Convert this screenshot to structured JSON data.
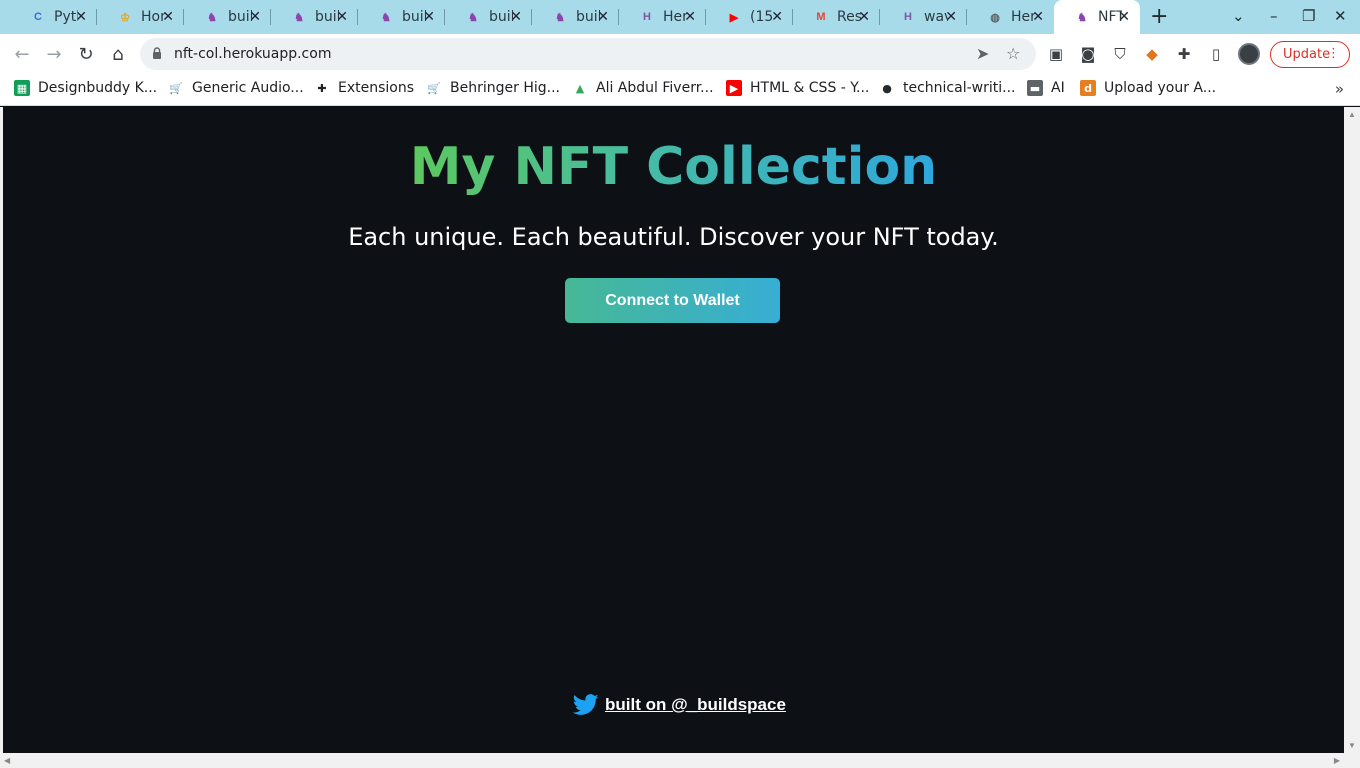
{
  "browser": {
    "tabs": [
      {
        "label": "Pyth",
        "icon": "c-logo-icon",
        "color": "#3b6fd8"
      },
      {
        "label": "Hon",
        "icon": "trophy-icon",
        "color": "#e8a317"
      },
      {
        "label": "buil",
        "icon": "unicorn-icon",
        "color": "#8e44ad"
      },
      {
        "label": "buil",
        "icon": "unicorn-icon",
        "color": "#8e44ad"
      },
      {
        "label": "buil",
        "icon": "unicorn-icon",
        "color": "#8e44ad"
      },
      {
        "label": "buil",
        "icon": "unicorn-icon",
        "color": "#8e44ad"
      },
      {
        "label": "buil",
        "icon": "unicorn-icon",
        "color": "#8e44ad"
      },
      {
        "label": "Her",
        "icon": "heroku-icon",
        "color": "#79589f"
      },
      {
        "label": "(15",
        "icon": "youtube-icon",
        "color": "#ff0000"
      },
      {
        "label": "Res",
        "icon": "gmail-icon",
        "color": "#ea4335"
      },
      {
        "label": "wav",
        "icon": "heroku-icon",
        "color": "#79589f"
      },
      {
        "label": "Her",
        "icon": "globe-icon",
        "color": "#5f6368"
      },
      {
        "label": "NFT",
        "icon": "unicorn-icon",
        "color": "#8e44ad",
        "active": true
      }
    ],
    "url": "nft-col.herokuapp.com",
    "update_label": "Update",
    "bookmarks": [
      {
        "label": "Designbuddy K...",
        "icon": "sheets-icon",
        "color": "#0f9d58"
      },
      {
        "label": "Generic Audio...",
        "icon": "cart-icon",
        "color": "#d35400"
      },
      {
        "label": "Extensions",
        "icon": "puzzle-icon",
        "color": "#202124"
      },
      {
        "label": "Behringer Hig...",
        "icon": "cart-icon",
        "color": "#d35400"
      },
      {
        "label": "Ali Abdul Fiverr...",
        "icon": "drive-icon",
        "color": "#34a853"
      },
      {
        "label": "HTML & CSS - Y...",
        "icon": "youtube-icon",
        "color": "#ff0000"
      },
      {
        "label": "technical-writi...",
        "icon": "github-icon",
        "color": "#24292e"
      },
      {
        "label": "AI",
        "icon": "folder-icon",
        "color": "#5f6368"
      },
      {
        "label": "Upload your A...",
        "icon": "d-logo-icon",
        "color": "#e67e22"
      }
    ]
  },
  "page": {
    "title": "My NFT Collection",
    "subtitle": "Each unique. Each beautiful. Discover your NFT today.",
    "cta_label": "Connect to Wallet",
    "footer_link": "built on @_buildspace",
    "colors": {
      "background": "#0d1116",
      "gradient_start": "#5cc85e",
      "gradient_end": "#2ea8dd",
      "twitter": "#1da1f2"
    }
  }
}
